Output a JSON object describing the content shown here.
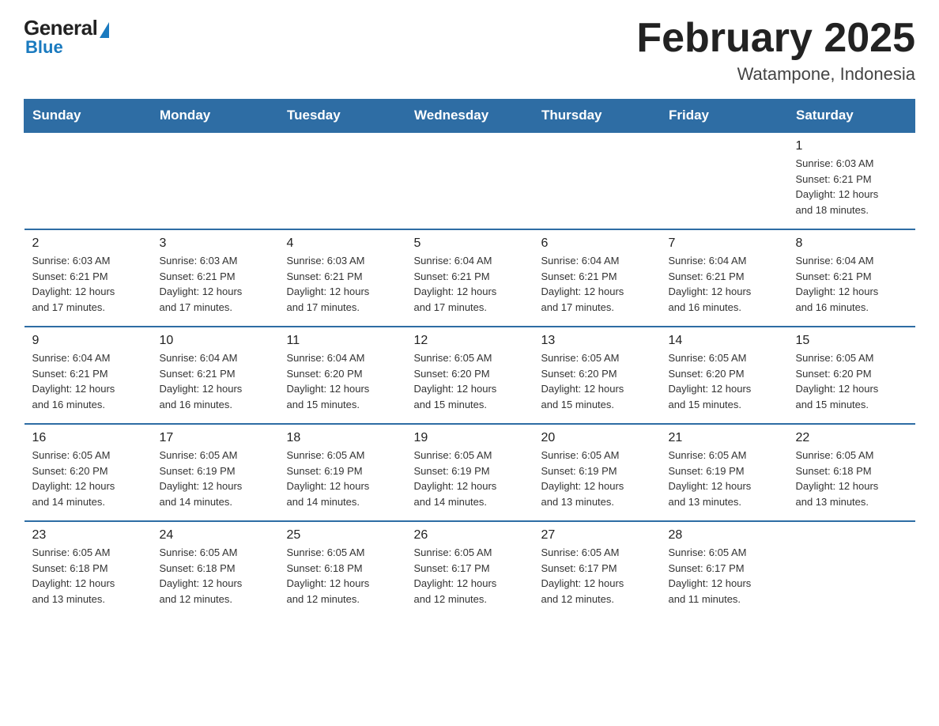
{
  "logo": {
    "general": "General",
    "blue": "Blue"
  },
  "title": "February 2025",
  "subtitle": "Watampone, Indonesia",
  "days_header": [
    "Sunday",
    "Monday",
    "Tuesday",
    "Wednesday",
    "Thursday",
    "Friday",
    "Saturday"
  ],
  "weeks": [
    [
      {
        "day": "",
        "info": ""
      },
      {
        "day": "",
        "info": ""
      },
      {
        "day": "",
        "info": ""
      },
      {
        "day": "",
        "info": ""
      },
      {
        "day": "",
        "info": ""
      },
      {
        "day": "",
        "info": ""
      },
      {
        "day": "1",
        "info": "Sunrise: 6:03 AM\nSunset: 6:21 PM\nDaylight: 12 hours\nand 18 minutes."
      }
    ],
    [
      {
        "day": "2",
        "info": "Sunrise: 6:03 AM\nSunset: 6:21 PM\nDaylight: 12 hours\nand 17 minutes."
      },
      {
        "day": "3",
        "info": "Sunrise: 6:03 AM\nSunset: 6:21 PM\nDaylight: 12 hours\nand 17 minutes."
      },
      {
        "day": "4",
        "info": "Sunrise: 6:03 AM\nSunset: 6:21 PM\nDaylight: 12 hours\nand 17 minutes."
      },
      {
        "day": "5",
        "info": "Sunrise: 6:04 AM\nSunset: 6:21 PM\nDaylight: 12 hours\nand 17 minutes."
      },
      {
        "day": "6",
        "info": "Sunrise: 6:04 AM\nSunset: 6:21 PM\nDaylight: 12 hours\nand 17 minutes."
      },
      {
        "day": "7",
        "info": "Sunrise: 6:04 AM\nSunset: 6:21 PM\nDaylight: 12 hours\nand 16 minutes."
      },
      {
        "day": "8",
        "info": "Sunrise: 6:04 AM\nSunset: 6:21 PM\nDaylight: 12 hours\nand 16 minutes."
      }
    ],
    [
      {
        "day": "9",
        "info": "Sunrise: 6:04 AM\nSunset: 6:21 PM\nDaylight: 12 hours\nand 16 minutes."
      },
      {
        "day": "10",
        "info": "Sunrise: 6:04 AM\nSunset: 6:21 PM\nDaylight: 12 hours\nand 16 minutes."
      },
      {
        "day": "11",
        "info": "Sunrise: 6:04 AM\nSunset: 6:20 PM\nDaylight: 12 hours\nand 15 minutes."
      },
      {
        "day": "12",
        "info": "Sunrise: 6:05 AM\nSunset: 6:20 PM\nDaylight: 12 hours\nand 15 minutes."
      },
      {
        "day": "13",
        "info": "Sunrise: 6:05 AM\nSunset: 6:20 PM\nDaylight: 12 hours\nand 15 minutes."
      },
      {
        "day": "14",
        "info": "Sunrise: 6:05 AM\nSunset: 6:20 PM\nDaylight: 12 hours\nand 15 minutes."
      },
      {
        "day": "15",
        "info": "Sunrise: 6:05 AM\nSunset: 6:20 PM\nDaylight: 12 hours\nand 15 minutes."
      }
    ],
    [
      {
        "day": "16",
        "info": "Sunrise: 6:05 AM\nSunset: 6:20 PM\nDaylight: 12 hours\nand 14 minutes."
      },
      {
        "day": "17",
        "info": "Sunrise: 6:05 AM\nSunset: 6:19 PM\nDaylight: 12 hours\nand 14 minutes."
      },
      {
        "day": "18",
        "info": "Sunrise: 6:05 AM\nSunset: 6:19 PM\nDaylight: 12 hours\nand 14 minutes."
      },
      {
        "day": "19",
        "info": "Sunrise: 6:05 AM\nSunset: 6:19 PM\nDaylight: 12 hours\nand 14 minutes."
      },
      {
        "day": "20",
        "info": "Sunrise: 6:05 AM\nSunset: 6:19 PM\nDaylight: 12 hours\nand 13 minutes."
      },
      {
        "day": "21",
        "info": "Sunrise: 6:05 AM\nSunset: 6:19 PM\nDaylight: 12 hours\nand 13 minutes."
      },
      {
        "day": "22",
        "info": "Sunrise: 6:05 AM\nSunset: 6:18 PM\nDaylight: 12 hours\nand 13 minutes."
      }
    ],
    [
      {
        "day": "23",
        "info": "Sunrise: 6:05 AM\nSunset: 6:18 PM\nDaylight: 12 hours\nand 13 minutes."
      },
      {
        "day": "24",
        "info": "Sunrise: 6:05 AM\nSunset: 6:18 PM\nDaylight: 12 hours\nand 12 minutes."
      },
      {
        "day": "25",
        "info": "Sunrise: 6:05 AM\nSunset: 6:18 PM\nDaylight: 12 hours\nand 12 minutes."
      },
      {
        "day": "26",
        "info": "Sunrise: 6:05 AM\nSunset: 6:17 PM\nDaylight: 12 hours\nand 12 minutes."
      },
      {
        "day": "27",
        "info": "Sunrise: 6:05 AM\nSunset: 6:17 PM\nDaylight: 12 hours\nand 12 minutes."
      },
      {
        "day": "28",
        "info": "Sunrise: 6:05 AM\nSunset: 6:17 PM\nDaylight: 12 hours\nand 11 minutes."
      },
      {
        "day": "",
        "info": ""
      }
    ]
  ]
}
